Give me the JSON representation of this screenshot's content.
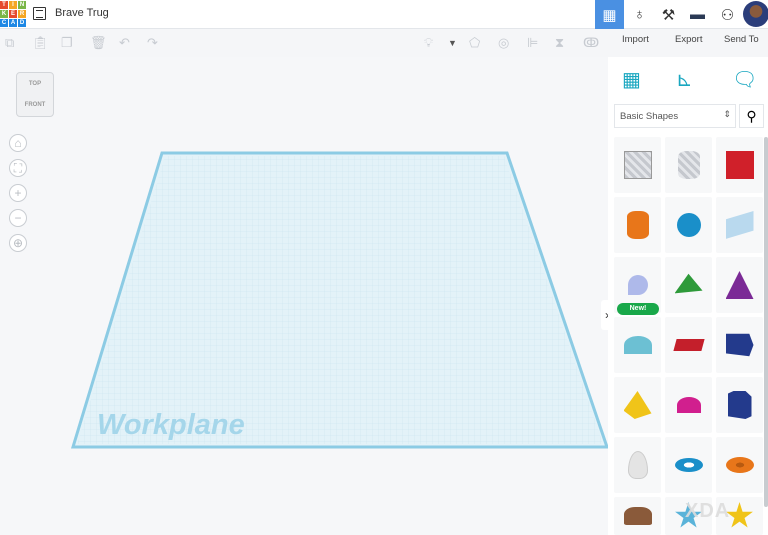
{
  "app": {
    "logo_letters": [
      "T",
      "I",
      "N",
      "K",
      "E",
      "R",
      "C",
      "A",
      "D"
    ],
    "project_title": "Brave Trug"
  },
  "topbar": {
    "icons": [
      "grid-view-icon",
      "sim-lab-icon",
      "pickaxe-icon",
      "bricks-icon",
      "add-user-icon"
    ]
  },
  "toolbar": {
    "import_label": "Import",
    "export_label": "Export",
    "send_to_label": "Send To"
  },
  "viewcube": {
    "top": "TOP",
    "front": "FRONT"
  },
  "workplane": {
    "label": "Workplane"
  },
  "panel": {
    "category": "Basic Shapes",
    "new_badge": "New!",
    "shapes": [
      "Box Hole",
      "Cylinder Hole",
      "Box",
      "Cylinder",
      "Sphere",
      "Scribble",
      "Sketch",
      "Roof",
      "Cone",
      "Round Roof",
      "Text",
      "Polygon",
      "Pyramid",
      "Half Sphere",
      "Hexagonal Prism",
      "Paraboloid",
      "Torus",
      "Tube",
      "Heart",
      "Star",
      "Star"
    ]
  },
  "watermark": "XDA"
}
